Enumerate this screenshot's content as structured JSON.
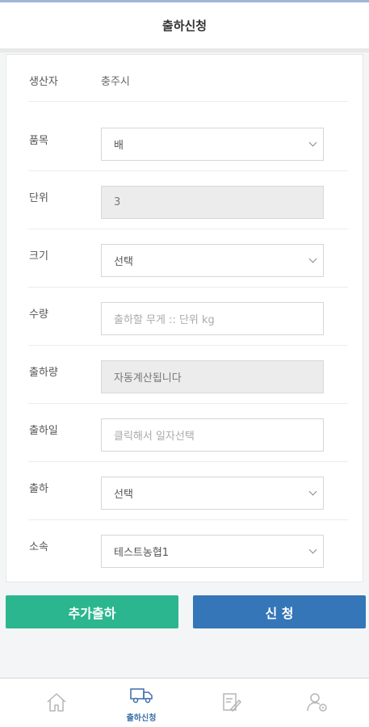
{
  "header": {
    "title": "출하신청"
  },
  "form": {
    "producer": {
      "label": "생산자",
      "value": "충주시"
    },
    "item": {
      "label": "품목",
      "value": "배"
    },
    "unit": {
      "label": "단위",
      "value": "3"
    },
    "size": {
      "label": "크기",
      "value": "선택"
    },
    "quantity": {
      "label": "수량",
      "placeholder": "출하할 무게 :: 단위 kg"
    },
    "shipment_amount": {
      "label": "출하량",
      "placeholder": "자동계산됩니다"
    },
    "ship_date": {
      "label": "출하일",
      "placeholder": "클릭해서 일자선택"
    },
    "shipment": {
      "label": "출하",
      "value": "선택"
    },
    "affiliation": {
      "label": "소속",
      "value": "테스트농협1"
    }
  },
  "buttons": {
    "add_shipment": "추가출하",
    "apply": "신 청"
  },
  "tabbar": {
    "items": [
      {
        "icon": "home-icon",
        "label": ""
      },
      {
        "icon": "truck-icon",
        "label": "출하신청",
        "active": true
      },
      {
        "icon": "document-edit-icon",
        "label": ""
      },
      {
        "icon": "user-settings-icon",
        "label": ""
      }
    ]
  },
  "colors": {
    "accent_green": "#2bb68f",
    "accent_blue": "#3476b8",
    "active_tab": "#3b6fa8"
  }
}
